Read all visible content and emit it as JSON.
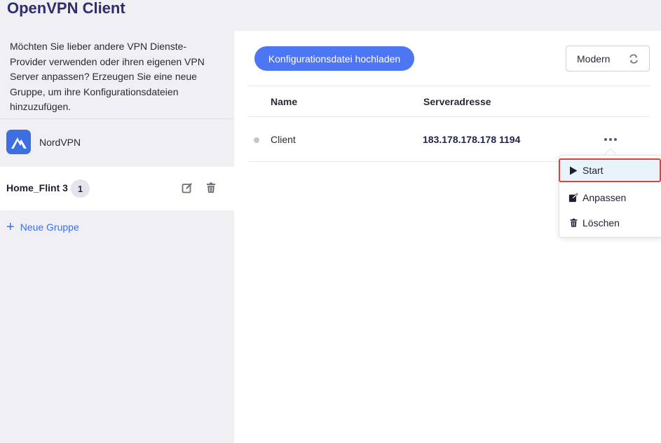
{
  "app": {
    "title": "OpenVPN Client"
  },
  "sidebar": {
    "intro": "Möchten Sie lieber andere VPN Dienste-Provider verwenden oder ihren eigenen VPN Server anpassen? Erzeugen Sie eine neue Gruppe, um ihre Konfigurationsdateien hinzuzufügen.",
    "provider": {
      "label": "NordVPN",
      "icon": "nordvpn-logo",
      "color": "#3e6fe0"
    },
    "group": {
      "name": "Home_Flint 3",
      "count": "1",
      "edit_icon": "edit-icon",
      "delete_icon": "trash-icon"
    },
    "new_group": {
      "label": "Neue Gruppe",
      "icon": "plus-icon",
      "color": "#3b6ef5"
    }
  },
  "toolbar": {
    "upload_label": "Konfigurationsdatei hochladen",
    "upload_color": "#4d76f5",
    "mode": {
      "value": "Modern",
      "icon": "swap-icon"
    }
  },
  "table": {
    "headers": [
      "Name",
      "Serveradresse"
    ],
    "rows": [
      {
        "name": "Client",
        "address": "183.178.178.178 1194",
        "status": "idle"
      }
    ]
  },
  "menu": {
    "items": [
      {
        "label": "Start",
        "icon": "play-icon",
        "highlighted": true
      },
      {
        "label": "Anpassen",
        "icon": "edit-icon"
      },
      {
        "label": "Löschen",
        "icon": "trash-icon"
      }
    ],
    "highlight_color": "#e0413a"
  }
}
